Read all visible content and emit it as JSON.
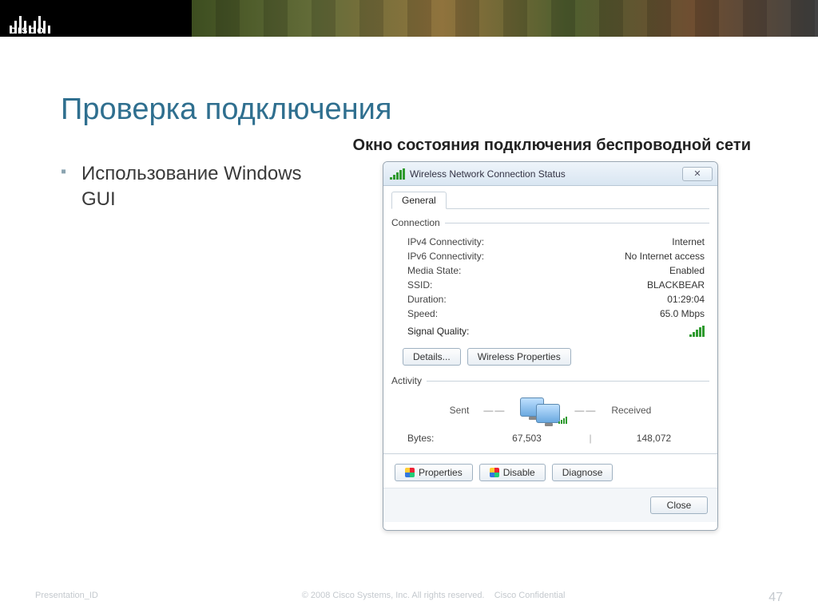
{
  "slide": {
    "title": "Проверка подключения",
    "subtitle": "Окно состояния подключения беспроводной сети",
    "bullet1": "Использование Windows GUI"
  },
  "dialog": {
    "title": "Wireless Network Connection Status",
    "tab_general": "General",
    "group_connection": "Connection",
    "kv": {
      "ipv4_label": "IPv4 Connectivity:",
      "ipv4_value": "Internet",
      "ipv6_label": "IPv6 Connectivity:",
      "ipv6_value": "No Internet access",
      "media_label": "Media State:",
      "media_value": "Enabled",
      "ssid_label": "SSID:",
      "ssid_value": "BLACKBEAR",
      "duration_label": "Duration:",
      "duration_value": "01:29:04",
      "speed_label": "Speed:",
      "speed_value": "65.0 Mbps",
      "sigq_label": "Signal Quality:"
    },
    "btn_details": "Details...",
    "btn_wprops": "Wireless Properties",
    "group_activity": "Activity",
    "act_sent": "Sent",
    "act_received": "Received",
    "bytes_label": "Bytes:",
    "bytes_sent": "67,503",
    "bytes_recv": "148,072",
    "btn_properties": "Properties",
    "btn_disable": "Disable",
    "btn_diagnose": "Diagnose",
    "btn_close": "Close"
  },
  "footer": {
    "left": "Presentation_ID",
    "mid": "© 2008 Cisco Systems, Inc. All rights reserved.",
    "right": "Cisco Confidential",
    "page": "47"
  }
}
